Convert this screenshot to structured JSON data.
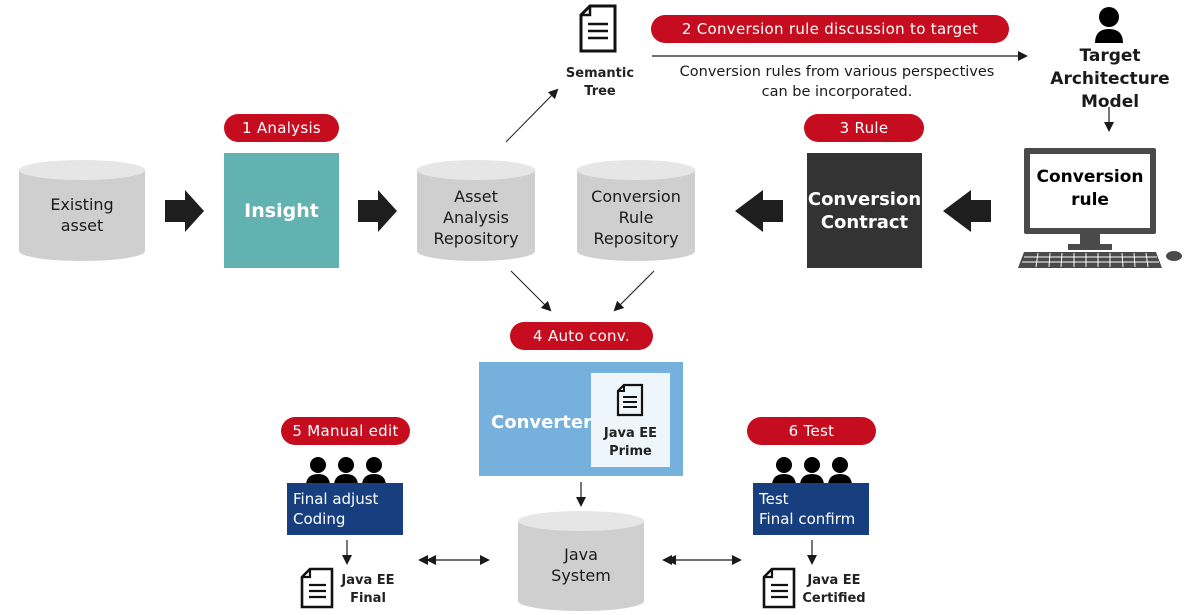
{
  "steps": {
    "s1": "1 Analysis",
    "s2": "2 Conversion rule discussion to target",
    "s3": "3 Rule",
    "s4": "4 Auto conv.",
    "s5": "5 Manual edit",
    "s6": "6 Test"
  },
  "nodes": {
    "existing_asset": "Existing\nasset",
    "insight": "Insight",
    "asset_repo": "Asset\nAnalysis\nRepository",
    "rule_repo": "Conversion\nRule\nRepository",
    "contract": "Conversion\nContract",
    "target_model": "Target\nArchitecture\nModel",
    "conversion_rule": "Conversion\nrule",
    "semantic_tree": "Semantic\nTree",
    "converter": "Converter",
    "prime": "Java EE\nPrime",
    "java_system": "Java\nSystem",
    "final_adjust": "Final adjust\nCoding",
    "test_confirm": "Test\nFinal confirm",
    "java_final": "Java EE\nFinal",
    "java_certified": "Java EE\nCertified"
  },
  "notes": {
    "rules_note": "Conversion rules from various perspectives\ncan be incorporated."
  },
  "colors": {
    "step_red": "#c50d1f",
    "insight_teal": "#63b2b2",
    "contract_dark": "#333333",
    "converter_blue": "#75b1dc",
    "team_navy": "#173e7e",
    "repo_gray": "#cfcfcf"
  }
}
